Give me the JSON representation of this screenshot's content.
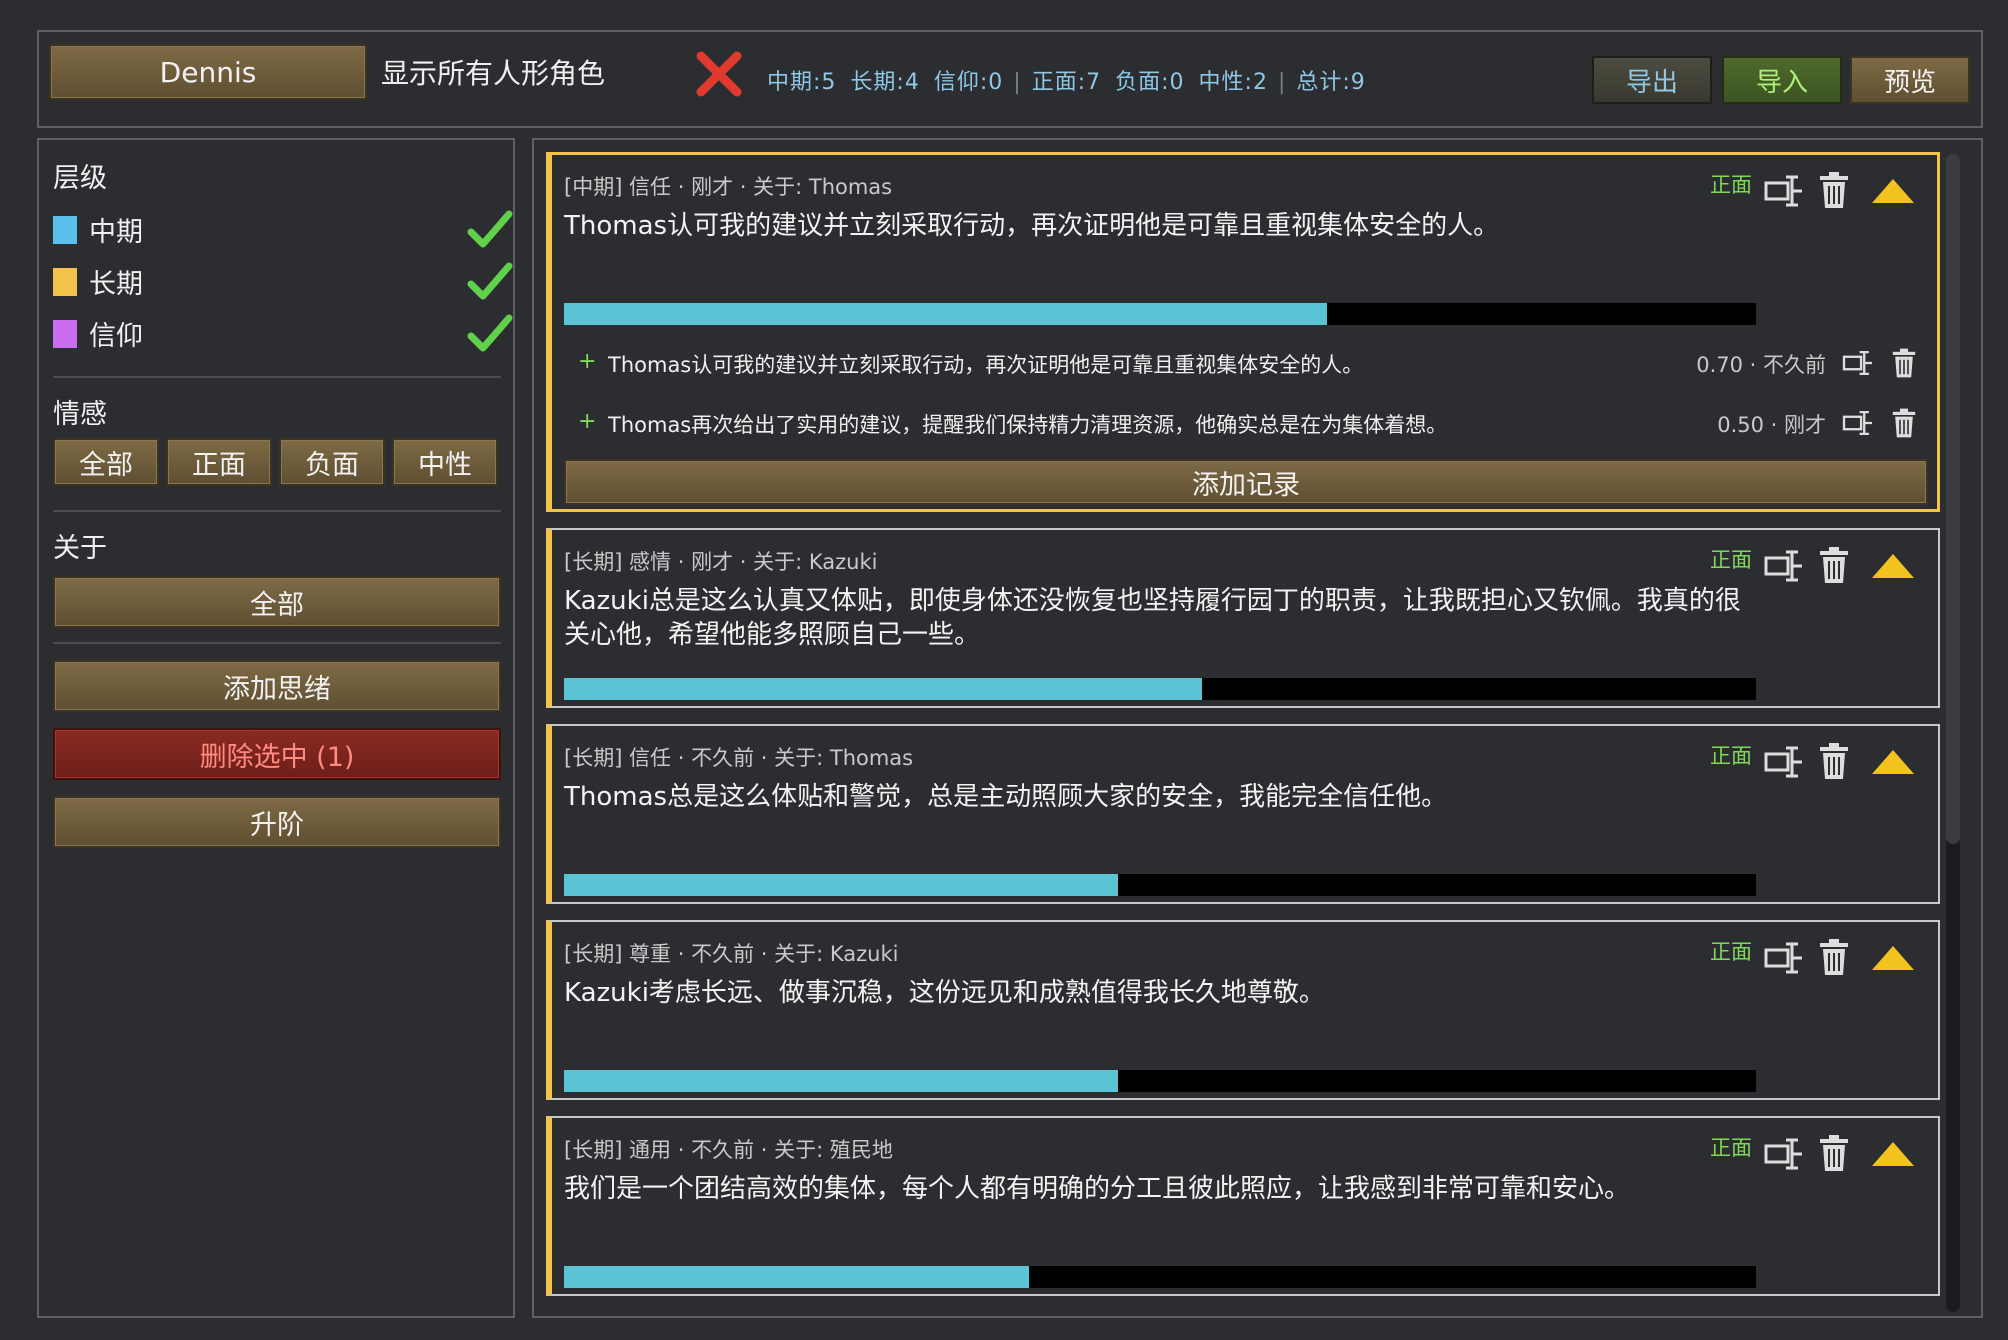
{
  "header": {
    "character": "Dennis",
    "show_all_label": "显示所有人形角色",
    "stats": {
      "mid": "中期:5",
      "long": "长期:4",
      "faith": "信仰:0",
      "positive": "正面:7",
      "negative": "负面:0",
      "neutral": "中性:2",
      "total": "总计:9"
    },
    "separator": "|",
    "export_label": "导出",
    "import_label": "导入",
    "preview_label": "预览"
  },
  "sidebar": {
    "layer_title": "层级",
    "layers": [
      {
        "label": "中期",
        "color": "#5bc0eb"
      },
      {
        "label": "长期",
        "color": "#f2c24b"
      },
      {
        "label": "信仰",
        "color": "#c86cf0"
      }
    ],
    "emotion_title": "情感",
    "emotion_buttons": [
      "全部",
      "正面",
      "负面",
      "中性"
    ],
    "about_title": "关于",
    "about_all": "全部",
    "add_thought": "添加思绪",
    "delete_selected": "删除选中 (1)",
    "promote": "升阶"
  },
  "cards": [
    {
      "meta": "[中期] 信任 · 刚才 · 关于: Thomas",
      "text": "Thomas认可我的建议并立刻采取行动，再次证明他是可靠且重视集体安全的人。",
      "valence": "正面",
      "progress": 0.64,
      "selected": true,
      "records": [
        {
          "text": "Thomas认可我的建议并立刻采取行动，再次证明他是可靠且重视集体安全的人。",
          "meta": "0.70 · 不久前"
        },
        {
          "text": "Thomas再次给出了实用的建议，提醒我们保持精力清理资源，他确实总是在为集体着想。",
          "meta": "0.50 · 刚才"
        }
      ],
      "add_record": "添加记录"
    },
    {
      "meta": "[长期] 感情 · 刚才 · 关于: Kazuki",
      "text": "Kazuki总是这么认真又体贴，即使身体还没恢复也坚持履行园丁的职责，让我既担心又钦佩。我真的很关心他，希望他能多照顾自己一些。",
      "valence": "正面",
      "progress": 0.535
    },
    {
      "meta": "[长期] 信任 · 不久前 · 关于: Thomas",
      "text": "Thomas总是这么体贴和警觉，总是主动照顾大家的安全，我能完全信任他。",
      "valence": "正面",
      "progress": 0.465
    },
    {
      "meta": "[长期] 尊重 · 不久前 · 关于: Kazuki",
      "text": "Kazuki考虑长远、做事沉稳，这份远见和成熟值得我长久地尊敬。",
      "valence": "正面",
      "progress": 0.465
    },
    {
      "meta": "[长期] 通用 · 不久前 · 关于: 殖民地",
      "text": "我们是一个团结高效的集体，每个人都有明确的分工且彼此照应，让我感到非常可靠和安心。",
      "valence": "正面",
      "progress": 0.39
    }
  ]
}
